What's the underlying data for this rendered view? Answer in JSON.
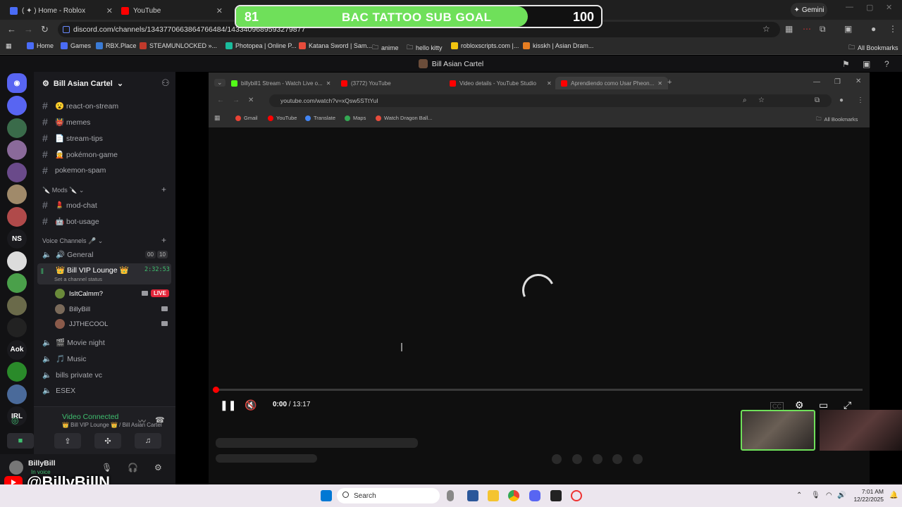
{
  "outer_browser": {
    "tabs": [
      {
        "label": "( ✦ ) Home - Roblox",
        "color": "#4a6cf7"
      },
      {
        "label": "YouTube",
        "color": "#ff0000"
      }
    ],
    "gemini_label": "Gemini",
    "url": "discord.com/channels/1343770663864766484/1433409689593279877",
    "bookmarks": [
      {
        "label": "Home",
        "color": "#4a6cf7"
      },
      {
        "label": "Games",
        "color": "#4a6cf7"
      },
      {
        "label": "RBX.Place",
        "color": "#3a7bd5"
      },
      {
        "label": "STEAMUNLOCKED »...",
        "color": "#c0392b"
      },
      {
        "label": "Photopea | Online P...",
        "color": "#1abc9c"
      },
      {
        "label": "Katana Sword | Sam...",
        "color": "#e74c3c"
      },
      {
        "label": "anime",
        "color": "#888888"
      },
      {
        "label": "hello kitty",
        "color": "#888888"
      },
      {
        "label": "robloxscripts.com |...",
        "color": "#f1c40f"
      },
      {
        "label": "kisskh | Asian Dram...",
        "color": "#e67e22"
      }
    ],
    "all_bookmarks": "All Bookmarks"
  },
  "goal": {
    "start": "81",
    "title": "BAC TATTOO SUB GOAL",
    "end": "100",
    "progress": 0.8
  },
  "discord": {
    "window_title": "Bill Asian Cartel",
    "server_name": "Bill Asian Cartel",
    "servers": [
      {
        "label": "",
        "color": "#5865f2"
      },
      {
        "label": "",
        "color": "#3a6b4a"
      },
      {
        "label": "",
        "color": "#8a6a9a"
      },
      {
        "label": "",
        "color": "#6a4a8a"
      },
      {
        "label": "",
        "color": "#a08a6a"
      },
      {
        "label": "",
        "color": "#b04a4a"
      },
      {
        "label": "NS",
        "color": "#1a1a1e"
      },
      {
        "label": "",
        "color": "#dcdcdc"
      },
      {
        "label": "",
        "color": "#4aa04a"
      },
      {
        "label": "",
        "color": "#6a6a4a"
      },
      {
        "label": "",
        "color": "#222222"
      },
      {
        "label": "Aok",
        "color": "#1a1a1e"
      },
      {
        "label": "",
        "color": "#2a8a2a"
      },
      {
        "label": "",
        "color": "#4a6a9a"
      },
      {
        "label": "IRL",
        "color": "#1a1a1e"
      }
    ],
    "text_channels": [
      {
        "label": "😮 react-on-stream"
      },
      {
        "label": "👹 memes"
      },
      {
        "label": "📄 stream-tips"
      },
      {
        "label": "🧝 pokémon-game"
      },
      {
        "label": "pokemon-spam"
      }
    ],
    "mods_category": "🔪 Mods 🔪",
    "mod_channels": [
      {
        "label": "💄 mod-chat"
      },
      {
        "label": "🤖 bot-usage"
      }
    ],
    "voice_category": "Voice Channels 🎤",
    "voice_general": "🔊 General",
    "voice_general_counts": [
      "00",
      "10"
    ],
    "vip_lounge": "👑 Bill VIP Lounge 👑",
    "vip_timer": "2:32:53",
    "vip_status": "Set a channel status",
    "vip_users": [
      {
        "name": "IsItCalmm?",
        "live": "LIVE"
      },
      {
        "name": "BillyBill",
        "live": ""
      },
      {
        "name": "JJTHECOOL",
        "live": ""
      }
    ],
    "other_voice": [
      {
        "label": "🎬 Movie night"
      },
      {
        "label": "🎵 Music"
      },
      {
        "label": "bills private vc"
      },
      {
        "label": "ESEX"
      }
    ],
    "voice_connected": "Video Connected",
    "voice_location": "👑 Bill VIP Lounge 👑 / Bill Asian Cartel",
    "username": "BillyBill",
    "user_status": "In voice"
  },
  "youtube_handle": "@BillyBillN",
  "inner_browser": {
    "tabs": [
      {
        "label": "billybill1 Stream - Watch Live o...",
        "color": "#53fc18"
      },
      {
        "label": "(3772) YouTube",
        "color": "#ff0000"
      },
      {
        "label": "Video details - YouTube Studio",
        "color": "#ff0000"
      },
      {
        "label": "Aprendiendo como Usar Pheon...",
        "color": "#ff0000"
      }
    ],
    "url": "youtube.com/watch?v=xQsw5STtYuI",
    "bookmarks": [
      {
        "label": "Gmail",
        "color": "#ea4335"
      },
      {
        "label": "YouTube",
        "color": "#ff0000"
      },
      {
        "label": "Translate",
        "color": "#4285f4"
      },
      {
        "label": "Maps",
        "color": "#34a853"
      },
      {
        "label": "Watch Dragon Ball...",
        "color": "#e74c3c"
      }
    ],
    "all_bookmarks": "All Bookmarks"
  },
  "player": {
    "time_current": "0:00",
    "time_total": "/ 13:17"
  },
  "taskbar": {
    "search_placeholder": "Search",
    "time": "7:01 AM",
    "date": "12/22/2025"
  }
}
